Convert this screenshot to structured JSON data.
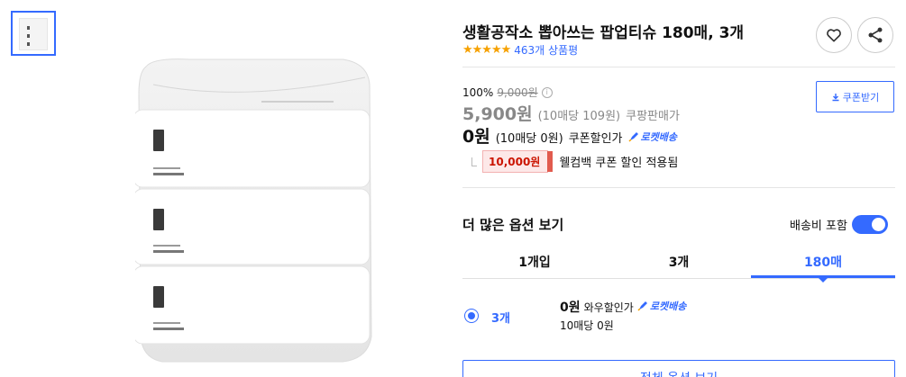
{
  "product": {
    "title": "생활공작소 뽑아쓰는 팝업티슈 180매, 3개",
    "stars": "★★★★★",
    "review_count": "463개 상품평"
  },
  "pricing": {
    "discount_percent": "100%",
    "original_price": "9,000원",
    "sale_price": "5,900원",
    "sale_unit": "(10매당 109원)",
    "sale_label": "쿠팡판매가",
    "coupon_price": "0원",
    "coupon_unit": "(10매당 0원)",
    "coupon_label": "쿠폰할인가",
    "rocket_label": "로켓배송",
    "coupon_button": "쿠폰받기"
  },
  "welcome": {
    "amount": "10,000원",
    "text": "웰컴백 쿠폰 할인 적용됨"
  },
  "options": {
    "title": "더 많은 옵션 보기",
    "shipping_toggle_label": "배송비 포함",
    "tabs": [
      "1개입",
      "3개",
      "180매"
    ],
    "active_tab_index": 2,
    "row": {
      "name": "3개",
      "price": "0원",
      "price_label": "와우할인가",
      "rocket_label": "로켓배송",
      "unit_price": "10매당 0원"
    },
    "all_options_button": "전체 옵션 보기"
  },
  "colors": {
    "accent": "#346aff",
    "star": "#f6a100",
    "coupon_red": "#cb1400"
  }
}
